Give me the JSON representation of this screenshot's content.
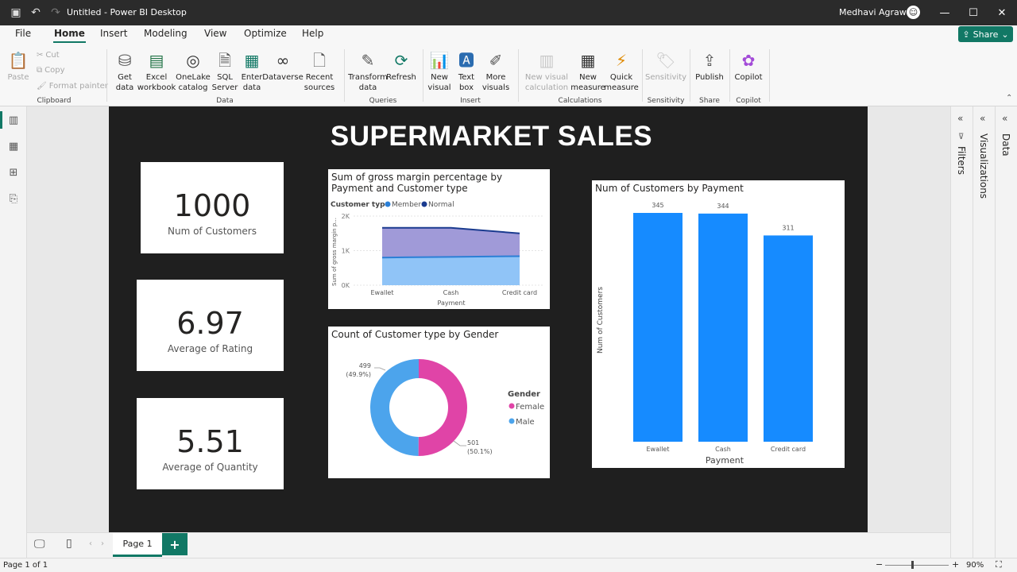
{
  "window": {
    "title": "Untitled - Power BI Desktop",
    "user": "Medhavi Agrawal"
  },
  "menu": {
    "items": [
      "File",
      "Home",
      "Insert",
      "Modeling",
      "View",
      "Optimize",
      "Help"
    ],
    "active": "Home"
  },
  "share": {
    "label": "Share"
  },
  "ribbon": {
    "clipboard": {
      "paste": "Paste",
      "cut": "Cut",
      "copy": "Copy",
      "format_painter": "Format painter",
      "group": "Clipboard"
    },
    "data": {
      "get_data": "Get data",
      "excel": "Excel workbook",
      "onelake": "OneLake catalog",
      "sql": "SQL Server",
      "enter": "Enter data",
      "dataverse": "Dataverse",
      "recent": "Recent sources",
      "group": "Data"
    },
    "queries": {
      "transform": "Transform data",
      "refresh": "Refresh",
      "group": "Queries"
    },
    "insert": {
      "new_visual": "New visual",
      "text_box": "Text box",
      "more_visuals": "More visuals",
      "group": "Insert"
    },
    "calculations": {
      "new_visual_calc": "New visual calculation",
      "new_measure": "New measure",
      "quick_measure": "Quick measure",
      "group": "Calculations"
    },
    "sensitivity": {
      "label": "Sensitivity",
      "group": "Sensitivity"
    },
    "share": {
      "publish": "Publish",
      "group": "Share"
    },
    "copilot": {
      "label": "Copilot",
      "group": "Copilot"
    }
  },
  "report": {
    "title": "SUPERMARKET SALES",
    "cards": [
      {
        "value": "1000",
        "label": "Num of Customers"
      },
      {
        "value": "6.97",
        "label": "Average of Rating"
      },
      {
        "value": "5.51",
        "label": "Average of Quantity"
      }
    ]
  },
  "panes": {
    "filters": "Filters",
    "visualizations": "Visualizations",
    "data": "Data"
  },
  "pages": {
    "tab": "Page 1",
    "add": "+"
  },
  "status": {
    "page": "Page 1 of 1",
    "zoom": "90%"
  },
  "colors": {
    "accent": "#117865",
    "area_member": "#90c4f7",
    "area_normal": "#a09ad8",
    "line_member": "#2b7fd6",
    "line_normal": "#1a3b8f",
    "bar": "#168bff",
    "female": "#e044a7",
    "male": "#4ca4ec"
  },
  "chart_data": [
    {
      "type": "area",
      "title": "Sum of gross margin percentage by Payment and Customer type",
      "legend_title": "Customer type",
      "categories": [
        "Ewallet",
        "Cash",
        "Credit card"
      ],
      "series": [
        {
          "name": "Member",
          "values": [
            800,
            820,
            840
          ]
        },
        {
          "name": "Normal",
          "values": [
            1660,
            1660,
            1500
          ]
        }
      ],
      "ylabel": "Sum of gross margin p...",
      "xlabel": "Payment",
      "yticks": [
        "0K",
        "1K",
        "2K"
      ],
      "ylim": [
        0,
        2000
      ],
      "stacked": true,
      "legend_position": "top-left"
    },
    {
      "type": "pie",
      "title": "Count of Customer type by Gender",
      "donut": true,
      "legend_title": "Gender",
      "slices": [
        {
          "name": "Female",
          "value": 501,
          "label": "501",
          "pct": "(50.1%)"
        },
        {
          "name": "Male",
          "value": 499,
          "label": "499",
          "pct": "(49.9%)"
        }
      ],
      "legend_position": "right"
    },
    {
      "type": "bar",
      "title": "Num of Customers by Payment",
      "categories": [
        "Ewallet",
        "Cash",
        "Credit card"
      ],
      "values": [
        345,
        344,
        311
      ],
      "xlabel": "Payment",
      "ylabel": "Num of Customers",
      "ylim": [
        0,
        345
      ]
    }
  ]
}
